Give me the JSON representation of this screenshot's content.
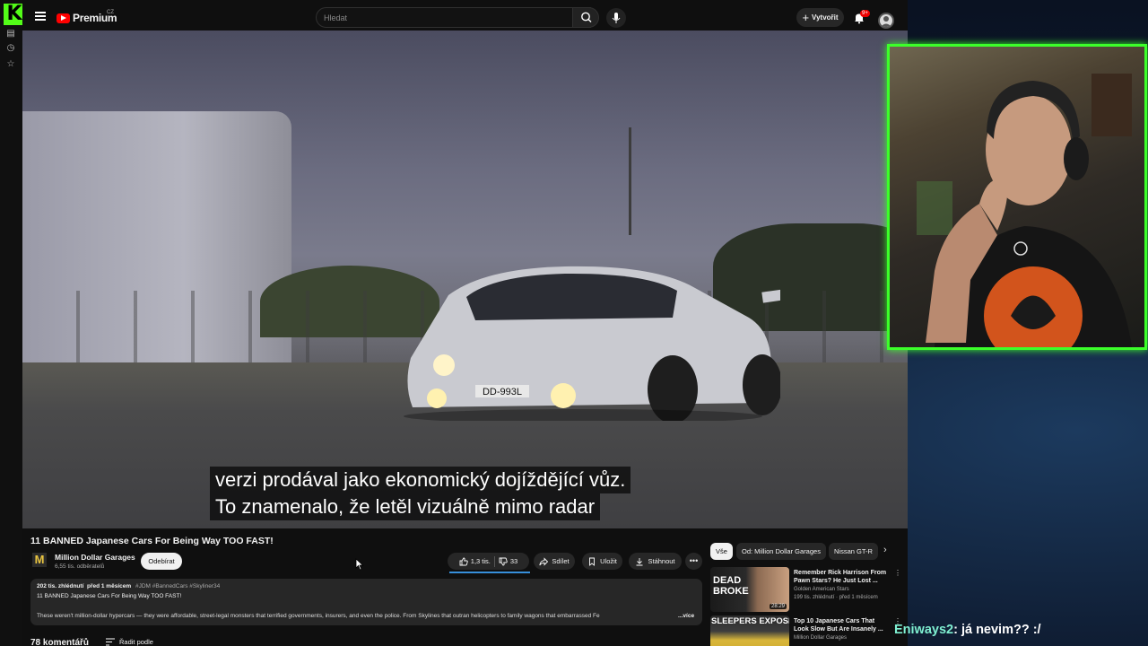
{
  "youtube": {
    "brand": "Premium",
    "country": "CZ",
    "search_placeholder": "Hledat",
    "create_label": "Vytvořit",
    "notification_count": "9+"
  },
  "video": {
    "subtitle_line1": "verzi prodával jako ekonomický dojíždějící vůz.",
    "subtitle_line2": "To znamenalo, že letěl vizuálně mimo radar",
    "title": "11 BANNED Japanese Cars For Being Way TOO FAST!",
    "license_plate": "DD-993L"
  },
  "channel": {
    "logo_letter": "M",
    "name": "Million Dollar Garages",
    "subscribers": "6,55 tis. odběratelů",
    "subscribe_label": "Odebírat"
  },
  "actions": {
    "likes": "1,3 tis.",
    "dislikes": "33",
    "share": "Sdílet",
    "save": "Uložit",
    "download": "Stáhnout"
  },
  "description": {
    "views": "202 tis. zhlédnutí",
    "age": "před 1 měsícem",
    "tags": "#JDM #BannedCars #Skyliner34",
    "title_line": "11 BANNED Japanese Cars For Being Way TOO FAST!",
    "text": "These weren't million-dollar hypercars — they were affordable, street-legal monsters that terrified governments, insurers, and even the police. From Skylines that outran helicopters to family wagons that embarrassed Fe",
    "more": "...více"
  },
  "comments": {
    "count": "78 komentářů",
    "sort_label": "Řadit podle"
  },
  "filter_chips": [
    "Vše",
    "Od: Million Dollar Garages",
    "Nissan GT-R"
  ],
  "recommendations": [
    {
      "thumb_text": "DEAD BROKE",
      "duration": "28:29",
      "title": "Remember Rick Harrison From Pawn Stars? He Just Lost ...",
      "channel": "Golden American Stars",
      "stats": "199 tis. zhlédnutí · před 1 měsícem"
    },
    {
      "thumb_text": "SLEEPERS EXPOSED",
      "duration": "",
      "title": "Top 10 Japanese Cars That Look Slow But Are Insanely ...",
      "channel": "Million Dollar Garages",
      "stats": ""
    }
  ],
  "chat": {
    "user": "Eniways2",
    "message": ": já nevim?? :/"
  },
  "icons": {
    "kick_logo": "K",
    "kick_green": "#53fc18",
    "webcam_border": "#3cff2a",
    "yt_red": "#ff0000",
    "chat_user_color": "#7ff0d2"
  }
}
